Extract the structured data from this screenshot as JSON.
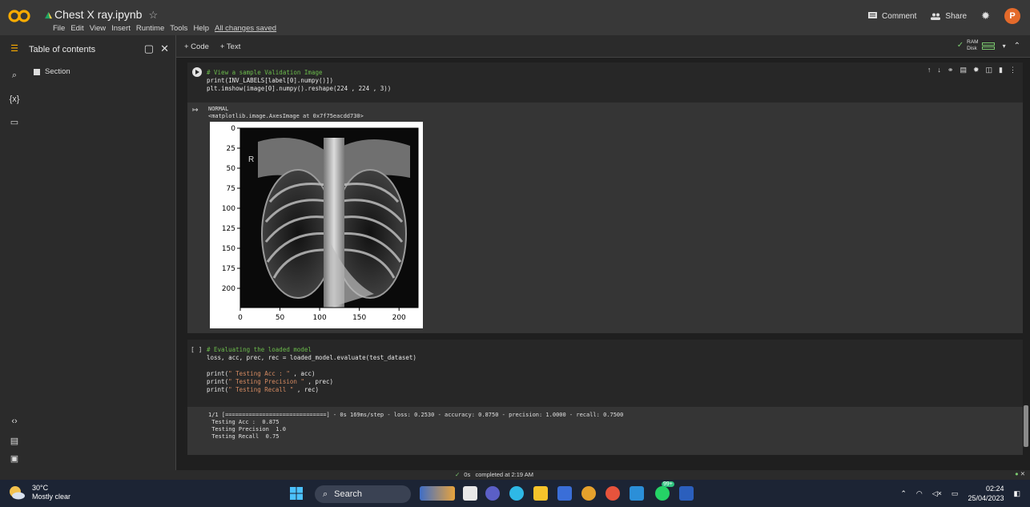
{
  "header": {
    "title": "Chest X ray.ipynb",
    "menu": [
      "File",
      "Edit",
      "View",
      "Insert",
      "Runtime",
      "Tools",
      "Help"
    ],
    "saved": "All changes saved",
    "comment": "Comment",
    "share": "Share",
    "avatar": "P",
    "colors": {
      "logo": "#f9ab00",
      "avatar": "#e46a2b"
    }
  },
  "toc": {
    "title": "Table of contents",
    "section": "Section"
  },
  "toolbar": {
    "add_code": "+ Code",
    "add_text": "+ Text",
    "ram": "RAM",
    "disk": "Disk"
  },
  "cell1": {
    "code": [
      "# View a sample Validation Image",
      "print(INV_LABELS[label[0].numpy()])",
      "plt.imshow(image[0].numpy().reshape(224 , 224 , 3))"
    ],
    "output": [
      "NORMAL",
      "<matplotlib.image.AxesImage at 0x7f75eacdd730>"
    ],
    "image_letter": "R"
  },
  "chart_data": {
    "type": "image",
    "x_ticks": [
      "0",
      "50",
      "100",
      "150",
      "200"
    ],
    "y_ticks": [
      "0",
      "25",
      "50",
      "75",
      "100",
      "125",
      "150",
      "175",
      "200"
    ],
    "xlim": [
      0,
      224
    ],
    "ylim": [
      224,
      0
    ]
  },
  "cell2": {
    "bracket": "[ ]",
    "code_comment": "# Evaluating the loaded model",
    "code_line2": "loss, acc, prec, rec = loaded_model.evaluate(test_dataset)",
    "prints": [
      {
        "a": "print(",
        "s": "\" Testing Acc : \"",
        "b": " , acc)"
      },
      {
        "a": "print(",
        "s": "\" Testing Precision \"",
        "b": " , prec)"
      },
      {
        "a": "print(",
        "s": "\" Testing Recall \"",
        "b": " , rec)"
      }
    ],
    "output": [
      "1/1 [==============================] - 0s 169ms/step - loss: 0.2530 - accuracy: 0.8750 - precision: 1.0000 - recall: 0.7500",
      " Testing Acc :  0.875",
      " Testing Precision  1.0",
      " Testing Recall  0.75"
    ]
  },
  "status": {
    "time": "0s",
    "message": "completed at 2:19 AM"
  },
  "taskbar": {
    "temp": "30°C",
    "weather": "Mostly clear",
    "search": "Search",
    "badge": "99+",
    "time": "02:24",
    "date": "25/04/2023"
  }
}
